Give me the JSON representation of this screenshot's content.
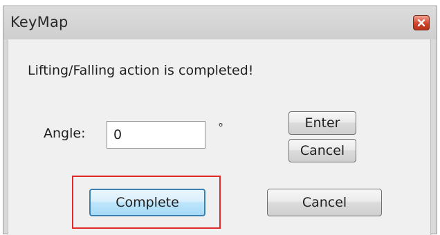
{
  "window": {
    "title": "KeyMap",
    "close_icon": "close-icon"
  },
  "dialog": {
    "message": "Lifting/Falling action is completed!",
    "angle": {
      "label": "Angle:",
      "value": "0",
      "unit": "°"
    },
    "buttons": {
      "enter": "Enter",
      "cancel_small": "Cancel",
      "complete": "Complete",
      "cancel": "Cancel"
    }
  },
  "annotation": {
    "highlight_color": "#e02a2a"
  }
}
